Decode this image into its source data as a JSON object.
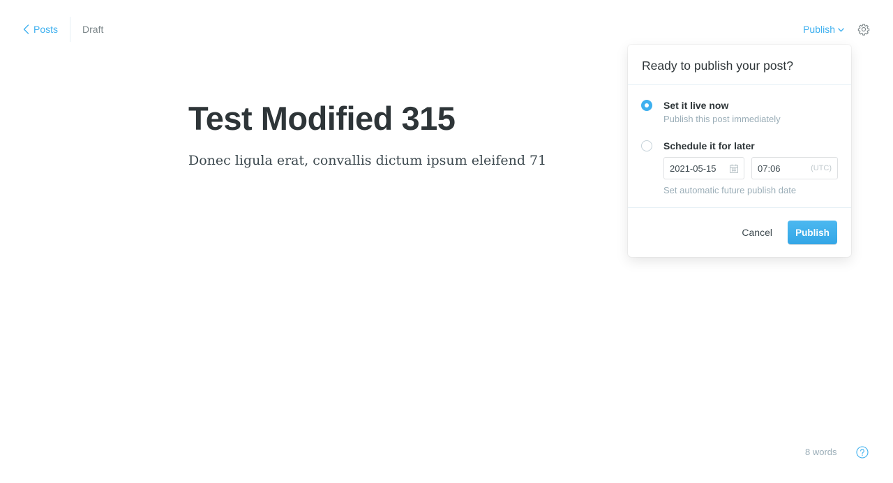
{
  "header": {
    "back_label": "Posts",
    "status": "Draft",
    "publish_menu_label": "Publish"
  },
  "post": {
    "title": "Test Modified 315",
    "body": "Donec ligula erat, convallis dictum ipsum eleifend 71"
  },
  "publish_popover": {
    "title": "Ready to publish your post?",
    "options": [
      {
        "label": "Set it live now",
        "description": "Publish this post immediately",
        "selected": true
      },
      {
        "label": "Schedule it for later",
        "description": "Set automatic future publish date",
        "selected": false
      }
    ],
    "schedule": {
      "date": "2021-05-15",
      "time": "07:06",
      "timezone": "(UTC)"
    },
    "cancel_label": "Cancel",
    "publish_label": "Publish"
  },
  "footer": {
    "word_count": "8 words"
  },
  "icons": {
    "back": "chevron-left-icon",
    "dropdown": "chevron-down-icon",
    "settings": "gear-icon",
    "calendar": "calendar-icon",
    "help": "question-circle-icon"
  },
  "colors": {
    "accent": "#3eb0ef",
    "title": "#2e3538",
    "muted": "#9baeb8"
  }
}
